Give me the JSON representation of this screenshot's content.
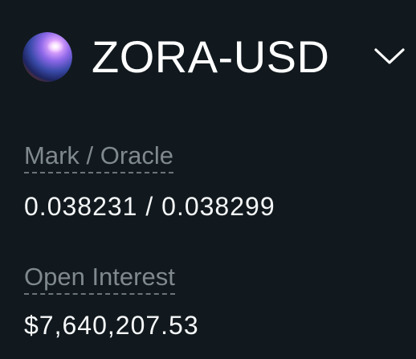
{
  "market": {
    "symbol": "ZORA-USD",
    "logo_icon": "zora-token-orb-icon",
    "dropdown_icon": "chevron-down-icon"
  },
  "stats": {
    "mark_oracle": {
      "label": "Mark / Oracle",
      "value": "0.038231 / 0.038299"
    },
    "open_interest": {
      "label": "Open Interest",
      "value": "$7,640,207.53"
    }
  },
  "colors": {
    "background": "#11191e",
    "label": "#7f898e",
    "value": "#f5f7f8"
  }
}
